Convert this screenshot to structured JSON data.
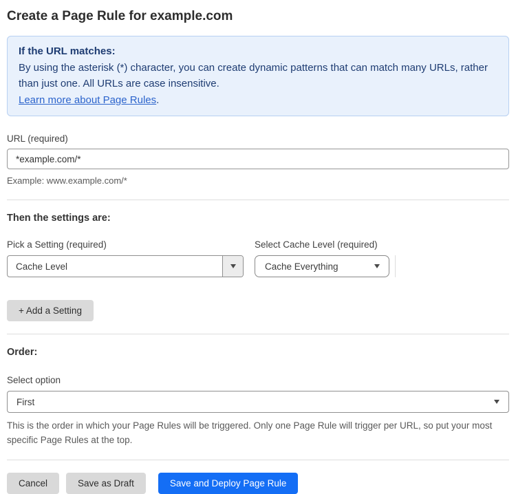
{
  "page": {
    "title": "Create a Page Rule for example.com"
  },
  "info_box": {
    "heading": "If the URL matches:",
    "body": "By using the asterisk (*) character, you can create dynamic patterns that can match many URLs, rather than just one. All URLs are case insensitive.",
    "link_label": "Learn more about Page Rules",
    "link_suffix": "."
  },
  "url_field": {
    "label": "URL (required)",
    "value": "*example.com/*",
    "example": "Example: www.example.com/*"
  },
  "settings_section": {
    "heading": "Then the settings are:",
    "setting_picker": {
      "label": "Pick a Setting (required)",
      "value": "Cache Level"
    },
    "cache_level_picker": {
      "label": "Select Cache Level (required)",
      "value": "Cache Everything"
    },
    "add_setting_label": "+ Add a Setting"
  },
  "order_section": {
    "heading": "Order:",
    "label": "Select option",
    "value": "First",
    "description": "This is the order in which your Page Rules will be triggered. Only one Page Rule will trigger per URL, so put your most specific Page Rules at the top."
  },
  "actions": {
    "cancel_label": "Cancel",
    "save_draft_label": "Save as Draft",
    "save_deploy_label": "Save and Deploy Page Rule"
  },
  "colors": {
    "primary_blue": "#146ef5",
    "info_box_bg": "#e9f1fc",
    "info_box_border": "#b7d0f2",
    "info_box_text": "#1e3c72",
    "link_blue": "#2c64cc",
    "gray_button_bg": "#d9d9d9"
  }
}
